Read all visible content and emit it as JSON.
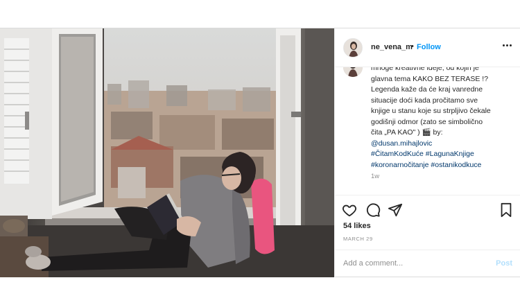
{
  "header": {
    "username": "ne_vena_m",
    "separator": "•",
    "follow_label": "Follow"
  },
  "caption": {
    "lines": [
      "mnoge kreativne ideje, od kojih je",
      "glavna tema KAKO BEZ TERASE !?",
      "Legenda kaže da će kraj vanredne",
      "situacije doći kada pročitamo sve",
      "knjige u stanu koje su strpljivo čekale",
      "godišnji odmor (zato se simbolično",
      "čita „PA KAO\" ) 🎬 by:"
    ],
    "mention": "@dusan.mihajlovic",
    "hashtags_line1": [
      "#ČitamKodKuće",
      "#LagunaKnjige"
    ],
    "hashtags_line2": [
      "#koronarnočitanje",
      "#ostanikodkuce"
    ],
    "age": "1w"
  },
  "stats": {
    "likes": "54 likes",
    "date": "MARCH 29"
  },
  "comment_box": {
    "placeholder": "Add a comment...",
    "post_label": "Post"
  },
  "icons": {
    "more": "more-options-icon",
    "like": "heart-icon",
    "comment": "comment-icon",
    "share": "share-icon",
    "save": "bookmark-icon"
  },
  "colors": {
    "link": "#0095f6",
    "hashtag": "#00376b",
    "muted": "#8e8e8e",
    "post_disabled": "#b2dffc"
  }
}
